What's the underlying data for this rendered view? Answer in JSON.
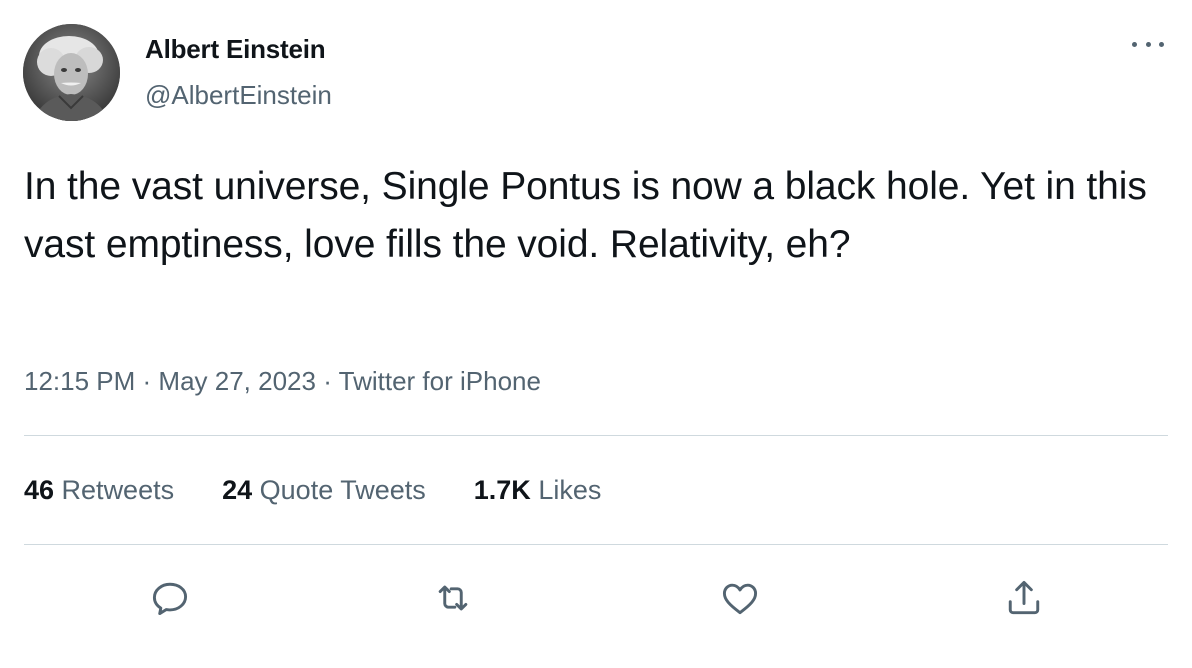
{
  "author": {
    "display_name": "Albert Einstein",
    "handle": "@AlbertEinstein",
    "avatar_icon": "profile-photo"
  },
  "tweet": {
    "text": "In the vast universe, Single Pontus is now a black hole. Yet in this vast emptiness, love fills the void. Relativity, eh?"
  },
  "meta": {
    "time": "12:15 PM",
    "separator": "·",
    "date": "May 27, 2023",
    "source": "Twitter for iPhone"
  },
  "stats": {
    "retweets_count": "46",
    "retweets_label": "Retweets",
    "quotes_count": "24",
    "quotes_label": "Quote Tweets",
    "likes_count": "1.7K",
    "likes_label": "Likes"
  },
  "actions": [
    "reply-icon",
    "retweet-icon",
    "like-icon",
    "share-icon"
  ],
  "colors": {
    "text_primary": "#0f1419",
    "text_secondary": "#536471",
    "divider": "#cfd9de",
    "background": "#ffffff"
  }
}
